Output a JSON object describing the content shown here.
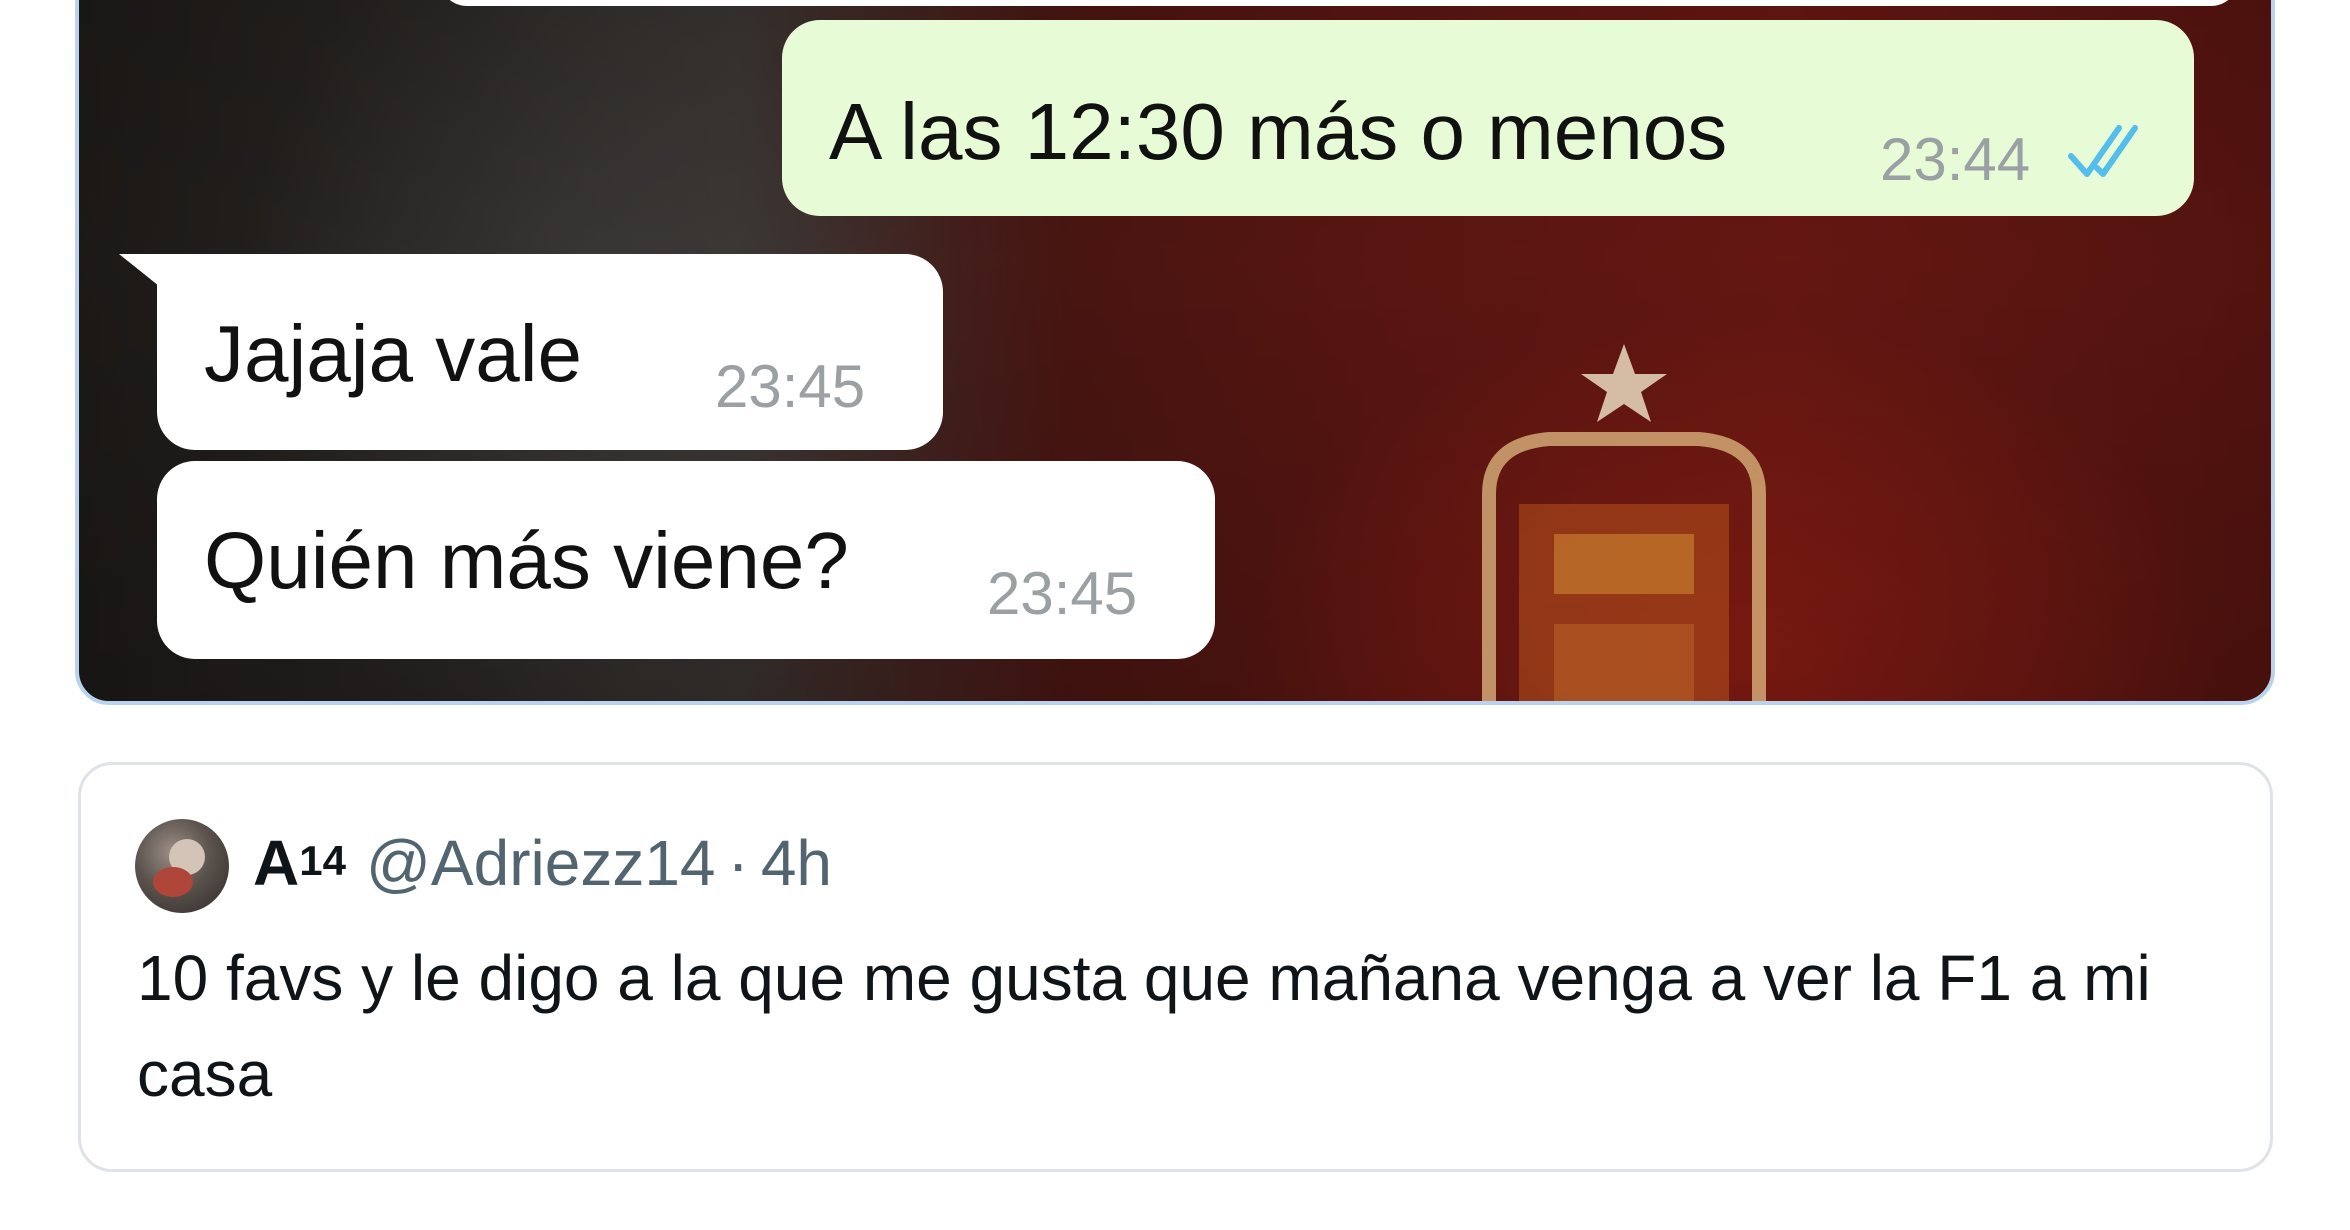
{
  "chat": {
    "messages": [
      {
        "direction": "outgoing",
        "text": "A las 12:30 más o menos",
        "time": "23:44",
        "status_icon": "double-check-icon",
        "status_color": "#53bdeb"
      },
      {
        "direction": "incoming",
        "text": "Jajaja vale",
        "time": "23:45"
      },
      {
        "direction": "incoming",
        "text": "Quién más viene?",
        "time": "23:45"
      }
    ],
    "colors": {
      "outgoing_bubble": "#e7fbd6",
      "incoming_bubble": "#ffffff",
      "card_border": "#b9d3ee"
    }
  },
  "quoted_tweet": {
    "display_name": "A",
    "display_name_superscript": "14",
    "handle": "@Adriezz14",
    "separator": "·",
    "time_ago": "4h",
    "text": "10 favs y le digo a la que me gusta que mañana venga a ver la F1 a mi casa",
    "avatar_icon": "user-avatar"
  }
}
